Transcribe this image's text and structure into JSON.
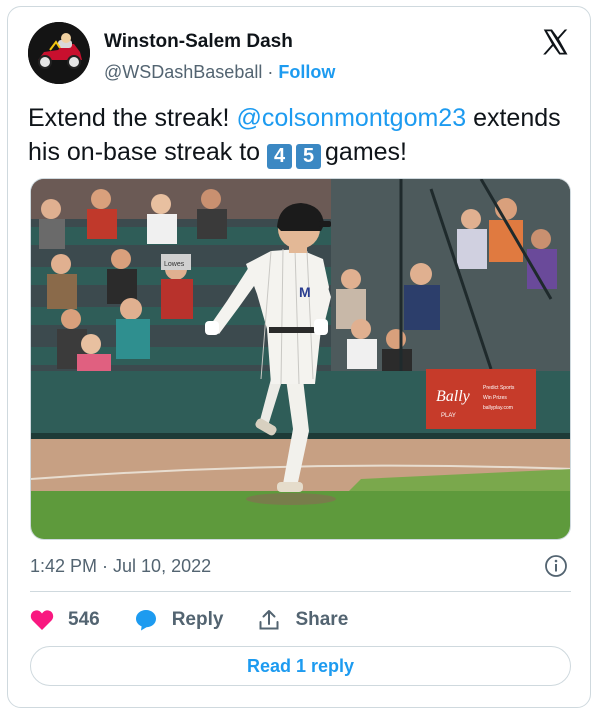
{
  "author": {
    "display_name": "Winston-Salem Dash",
    "handle": "@WSDashBaseball",
    "separator": "·",
    "follow_label": "Follow"
  },
  "tweet": {
    "text_before": "Extend the streak! ",
    "mention": "@colsonmontgom23",
    "text_middle": " extends his on-base streak to ",
    "digit_1": "4",
    "digit_2": "5",
    "text_after": "games!"
  },
  "media": {
    "sign_logo": "Bally",
    "sign_sub": "PLAY",
    "sign_line1": "Predict Sports",
    "sign_line2": "Win Prizes",
    "sign_line3": "ballyplay.com",
    "ad_board": "Lowes"
  },
  "meta": {
    "timestamp": "1:42 PM · Jul 10, 2022"
  },
  "actions": {
    "like_count": "546",
    "reply_label": "Reply",
    "share_label": "Share"
  },
  "footer": {
    "read_replies_label": "Read 1 reply"
  },
  "colors": {
    "accent": "#1d9bf0",
    "like": "#f91880",
    "text": "#0f1419",
    "muted": "#536471",
    "border": "#cfd9de"
  },
  "icons": {
    "brand": "x-logo-icon",
    "like": "heart-icon",
    "reply": "speech-bubble-icon",
    "share": "share-upload-icon",
    "info": "info-icon"
  }
}
